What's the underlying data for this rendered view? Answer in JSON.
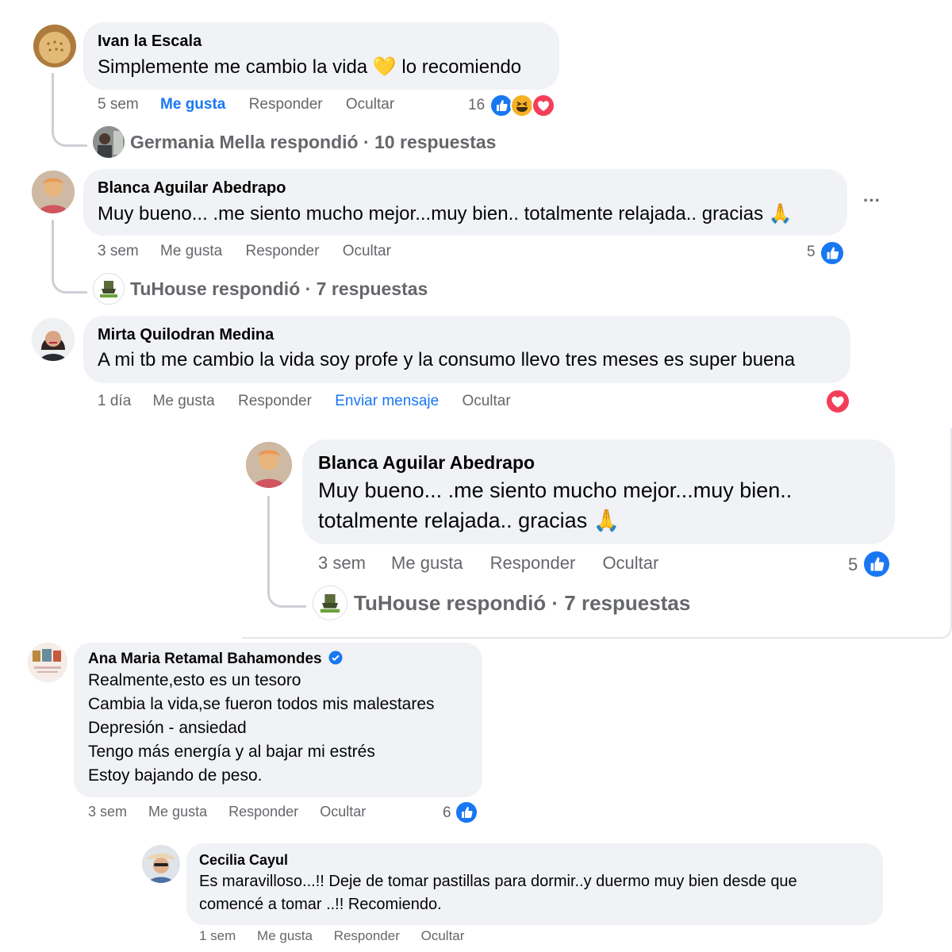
{
  "colors": {
    "bubble": "#f0f2f5",
    "meta": "#65676b",
    "like_blue": "#1877f2",
    "love_red": "#f33e58",
    "haha_yellow": "#f7b125"
  },
  "comments": [
    {
      "author": "Ivan la Escala",
      "text_before": "Simplemente me cambio la vida",
      "emoji": "💛",
      "text_after": "lo recomiendo",
      "time": "5 sem",
      "like": "Me gusta",
      "reply": "Responder",
      "hide": "Ocultar",
      "reaction_count": "16",
      "reactions": [
        "like-icon",
        "haha-icon",
        "love-icon"
      ],
      "replies_summary": "Germania Mella respondió · 10 respuestas"
    },
    {
      "author": "Blanca Aguilar Abedrapo",
      "text": "Muy bueno... .me siento mucho mejor...muy bien.. totalmente relajada.. gracias 🙏",
      "time": "3 sem",
      "like": "Me gusta",
      "reply": "Responder",
      "hide": "Ocultar",
      "more": "···",
      "reaction_count": "5",
      "reactions": [
        "like-icon"
      ],
      "replies_summary": "TuHouse respondió · 7 respuestas"
    },
    {
      "author": "Mirta Quilodran Medina",
      "text": "A mi tb me cambio la vida soy profe y la consumo llevo tres meses es super buena",
      "time": "1 día",
      "like": "Me gusta",
      "reply": "Responder",
      "message": "Enviar mensaje",
      "hide": "Ocultar",
      "reactions": [
        "love-icon"
      ]
    },
    {
      "author": "Blanca Aguilar Abedrapo",
      "text_line1": "Muy bueno... .me siento mucho mejor...muy bien..",
      "text_line2": "totalmente relajada.. gracias 🙏",
      "time": "3 sem",
      "like": "Me gusta",
      "reply": "Responder",
      "hide": "Ocultar",
      "reaction_count": "5",
      "reactions": [
        "like-icon"
      ],
      "replies_summary": "TuHouse respondió · 7 respuestas"
    },
    {
      "author": "Ana Maria Retamal Bahamondes",
      "verified": true,
      "lines": [
        "Realmente,esto es un tesoro",
        "Cambia la vida,se fueron todos mis malestares",
        "Depresión - ansiedad",
        "Tengo más energía y al bajar mi estrés",
        "Estoy bajando de peso."
      ],
      "time": "3 sem",
      "like": "Me gusta",
      "reply": "Responder",
      "hide": "Ocultar",
      "reaction_count": "6",
      "reactions": [
        "like-icon"
      ]
    },
    {
      "author": "Cecilia Cayul",
      "text_line1": "Es maravilloso...!! Deje de tomar pastillas para dormir..y duermo muy bien desde que",
      "text_line2": "comencé a tomar ..!! Recomiendo.",
      "time": "1 sem",
      "like": "Me gusta",
      "reply": "Responder",
      "hide": "Ocultar"
    }
  ]
}
